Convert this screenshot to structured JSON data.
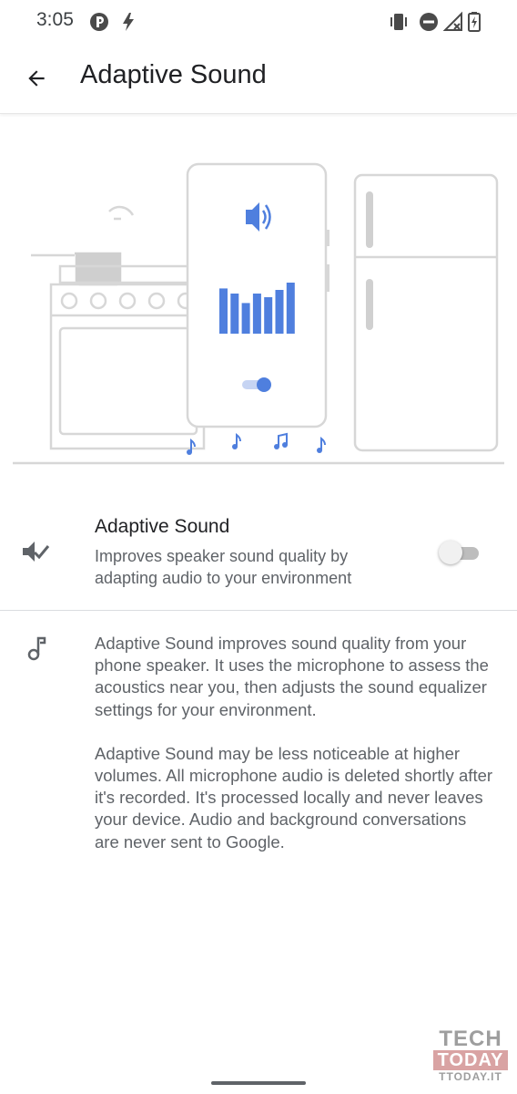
{
  "status_bar": {
    "time": "3:05",
    "left_icons": [
      "notification-app-icon",
      "flash-icon"
    ],
    "right_icons": [
      "vibrate-icon",
      "do-not-disturb-icon",
      "no-signal-icon",
      "battery-charging-icon"
    ]
  },
  "app_bar": {
    "back_icon": "arrow-back-icon",
    "title": "Adaptive Sound"
  },
  "illustration": {
    "accent_color": "#4f7fde",
    "line_color": "#d7d7d7",
    "equalizer_levels": [
      0.62,
      0.55,
      0.42,
      0.55,
      0.5,
      0.6,
      0.7
    ]
  },
  "setting": {
    "icon": "adaptive-sound-icon",
    "title": "Adaptive Sound",
    "summary": "Improves speaker sound quality by adapting audio to your environment",
    "enabled": false
  },
  "info": {
    "icon": "music-note-icon",
    "paragraphs": [
      "Adaptive Sound improves sound quality from your phone speaker. It uses the microphone to assess the acoustics near you, then adjusts the sound equalizer settings for your environment.",
      "Adaptive Sound may be less noticeable at higher volumes. All microphone audio is deleted shortly after it's recorded. It's processed locally and never leaves your device. Audio and background conversations are never sent to Google."
    ]
  },
  "watermark": {
    "line1": "TECH",
    "line2": "TODAY",
    "line3": "TTODAY.IT"
  }
}
